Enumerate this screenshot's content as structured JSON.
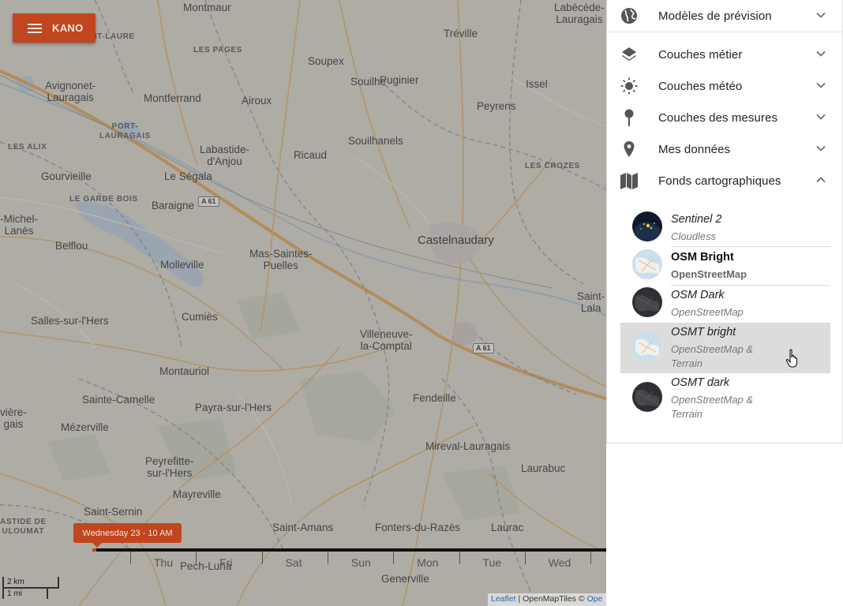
{
  "app": {
    "menu_label": "KANO",
    "time_label": "Wednesday 23 - 10 AM"
  },
  "map": {
    "places": [
      {
        "name": "Montmaur",
        "style": "normal"
      },
      {
        "name": "Labécède-\nLauragais",
        "style": "normal"
      },
      {
        "name": "SAINT-LAURE",
        "style": "caps"
      },
      {
        "name": "Tréville",
        "style": "normal"
      },
      {
        "name": "LES PAGES",
        "style": "caps"
      },
      {
        "name": "Soupex",
        "style": "normal"
      },
      {
        "name": "Puginier",
        "style": "normal"
      },
      {
        "name": "Avignonet-\nLauragais",
        "style": "normal"
      },
      {
        "name": "Montferrand",
        "style": "normal"
      },
      {
        "name": "Souilhe",
        "style": "normal"
      },
      {
        "name": "Issel",
        "style": "normal"
      },
      {
        "name": "Airoux",
        "style": "normal"
      },
      {
        "name": "Peyrens",
        "style": "normal"
      },
      {
        "name": "PORT-\nLAURAGAIS",
        "style": "caps"
      },
      {
        "name": "Souilhanels",
        "style": "normal"
      },
      {
        "name": "LES ALIX",
        "style": "caps"
      },
      {
        "name": "Labastide-\nd'Anjou",
        "style": "normal"
      },
      {
        "name": "Ricaud",
        "style": "normal"
      },
      {
        "name": "LES CROZES",
        "style": "caps"
      },
      {
        "name": "Gourvieille",
        "style": "normal"
      },
      {
        "name": "Le Ségala",
        "style": "normal"
      },
      {
        "name": "LE GARDE BOIS",
        "style": "caps"
      },
      {
        "name": "Baraigne",
        "style": "normal"
      },
      {
        "name": "-Michel-\nLanès",
        "style": "normal"
      },
      {
        "name": "Castelnaudary",
        "style": "big"
      },
      {
        "name": "Belflou",
        "style": "normal"
      },
      {
        "name": "Mas-Saintes-\nPuelles",
        "style": "normal"
      },
      {
        "name": "Molleville",
        "style": "normal"
      },
      {
        "name": "Saint-\nLala",
        "style": "normal"
      },
      {
        "name": "Salles-sur-l'Hers",
        "style": "normal"
      },
      {
        "name": "Cumiès",
        "style": "normal"
      },
      {
        "name": "Villeneuve-\nla-Comptal",
        "style": "normal"
      },
      {
        "name": "Montauriol",
        "style": "normal"
      },
      {
        "name": "Fendeille",
        "style": "normal"
      },
      {
        "name": "vière-\ngais",
        "style": "normal"
      },
      {
        "name": "Sainte-Camelle",
        "style": "normal"
      },
      {
        "name": "Payra-sur-l'Hers",
        "style": "normal"
      },
      {
        "name": "Mézerville",
        "style": "normal"
      },
      {
        "name": "Mireval-Lauragais",
        "style": "normal"
      },
      {
        "name": "Laurabuc",
        "style": "normal"
      },
      {
        "name": "Peyrefitte-\nsur-l'Hers",
        "style": "normal"
      },
      {
        "name": "Mayreville",
        "style": "normal"
      },
      {
        "name": "Saint-Sernin",
        "style": "normal"
      },
      {
        "name": "ASTIDE DE\nULOUMAT",
        "style": "caps"
      },
      {
        "name": "Saint-Amans",
        "style": "normal"
      },
      {
        "name": "Fonters-du-Razès",
        "style": "normal"
      },
      {
        "name": "Lauraс",
        "style": "normal"
      },
      {
        "name": "Pech-Luna",
        "style": "normal"
      },
      {
        "name": "Generville",
        "style": "normal"
      }
    ],
    "road_shields": [
      "A 61",
      "A 61"
    ],
    "timeline_days": [
      "Thu",
      "Fri",
      "Sat",
      "Sun",
      "Mon",
      "Tue",
      "Wed"
    ],
    "scale_km": "2 km",
    "scale_mi": "1 mi",
    "attribution": {
      "leaflet": "Leaflet",
      "sep": " | OpenMapTiles © ",
      "tail": "Ope"
    }
  },
  "panel": {
    "sections": [
      {
        "label": "Modèles de prévision",
        "icon": "globe-icon",
        "expanded": false
      },
      {
        "label": "Couches métier",
        "icon": "layers-icon",
        "expanded": false
      },
      {
        "label": "Couches météo",
        "icon": "sun-icon",
        "expanded": false
      },
      {
        "label": "Couches des mesures",
        "icon": "pin-icon",
        "expanded": false
      },
      {
        "label": "Mes données",
        "icon": "location-icon",
        "expanded": false
      },
      {
        "label": "Fonds cartographiques",
        "icon": "map-icon",
        "expanded": true
      }
    ],
    "base_layers": [
      {
        "name": "Sentinel 2",
        "sub": "Cloudless",
        "thumb": "night-earth-thumb",
        "active": false,
        "hover": false
      },
      {
        "name": "OSM Bright",
        "sub": "OpenStreetMap",
        "thumb": "light-map-thumb",
        "active": true,
        "hover": false
      },
      {
        "name": "OSM Dark",
        "sub": "OpenStreetMap",
        "thumb": "dark-map-thumb",
        "active": false,
        "hover": false
      },
      {
        "name": "OSMT bright",
        "sub": "OpenStreetMap &\nTerrain",
        "thumb": "light-map-thumb",
        "active": false,
        "hover": true
      },
      {
        "name": "OSMT dark",
        "sub": "OpenStreetMap &\nTerrain",
        "thumb": "dark-map-thumb",
        "active": false,
        "hover": false
      }
    ]
  },
  "colors": {
    "accent": "#c0461f",
    "panel_bg": "#ffffff",
    "hover_bg": "#dcdcdc"
  }
}
